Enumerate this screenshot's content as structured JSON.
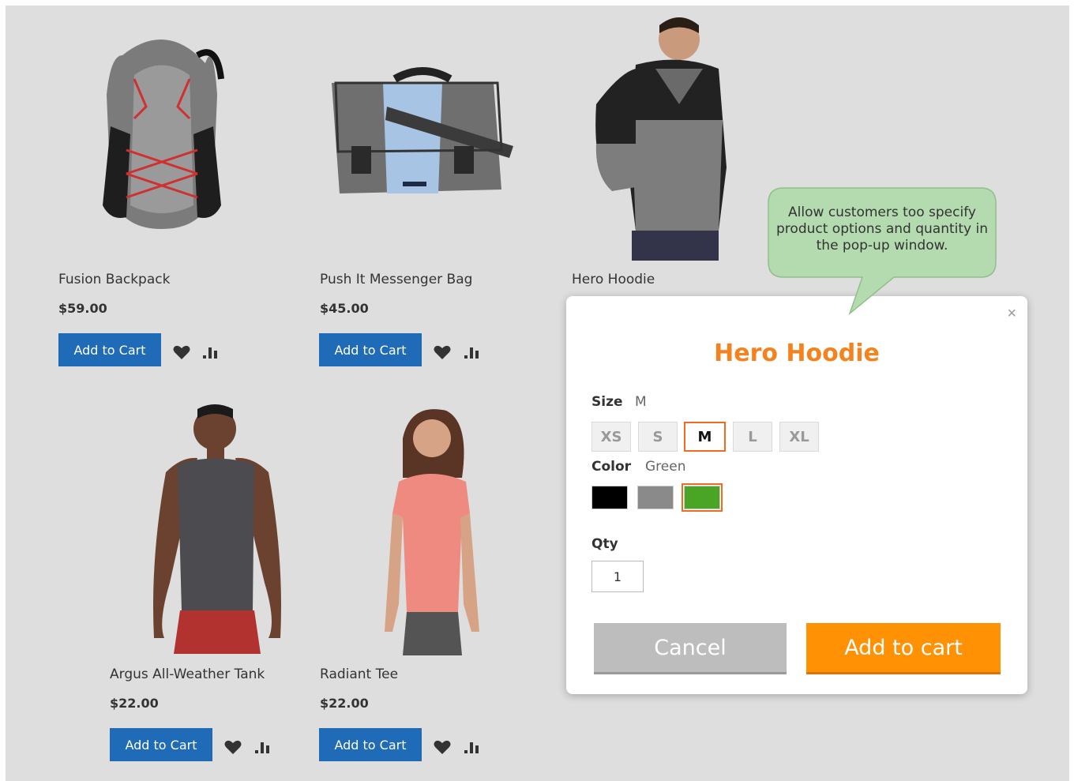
{
  "products": [
    {
      "name": "Fusion Backpack",
      "price": "$59.00",
      "button": "Add to Cart"
    },
    {
      "name": "Push It Messenger Bag",
      "price": "$45.00",
      "button": "Add to Cart"
    },
    {
      "name": "Hero Hoodie"
    },
    {
      "name": "Argus All-Weather Tank",
      "price": "$22.00",
      "button": "Add to Cart"
    },
    {
      "name": "Radiant Tee",
      "price": "$22.00",
      "button": "Add to Cart"
    }
  ],
  "callout": {
    "text": "Allow customers too specify product options and quantity in the pop-up window."
  },
  "modal": {
    "close": "×",
    "title": "Hero Hoodie",
    "size_label": "Size",
    "size_value": "M",
    "sizes": [
      "XS",
      "S",
      "M",
      "L",
      "XL"
    ],
    "selected_size": "M",
    "color_label": "Color",
    "color_value": "Green",
    "colors": [
      {
        "name": "Black",
        "hex": "#000000"
      },
      {
        "name": "Gray",
        "hex": "#8a8a8a"
      },
      {
        "name": "Green",
        "hex": "#4aa526"
      }
    ],
    "qty_label": "Qty",
    "qty_value": "1",
    "cancel_label": "Cancel",
    "add_label": "Add to cart"
  },
  "colors": {
    "primary_button": "#1f6bb8",
    "accent_orange": "#ff9105",
    "title_orange": "#f4821f",
    "callout_green": "#b4dab0"
  }
}
